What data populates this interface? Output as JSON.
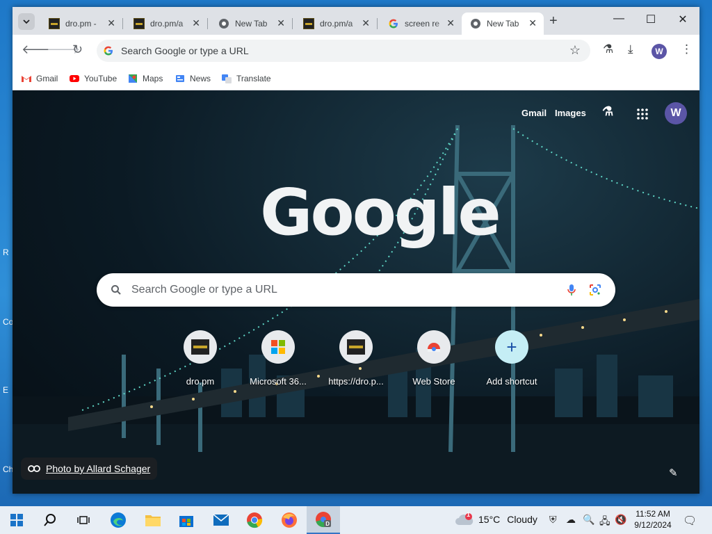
{
  "desktop": {
    "edge_letters": [
      "R",
      "Co",
      "E",
      "Ch"
    ]
  },
  "browser": {
    "tabs": [
      {
        "title": "dro.pm -",
        "favicon": "dro-pm-icon",
        "active": false
      },
      {
        "title": "dro.pm/a",
        "favicon": "dro-pm-icon",
        "active": false
      },
      {
        "title": "New Tab",
        "favicon": "chrome-icon",
        "active": false
      },
      {
        "title": "dro.pm/a",
        "favicon": "dro-pm-icon",
        "active": false
      },
      {
        "title": "screen re",
        "favicon": "google-g-icon",
        "active": false
      },
      {
        "title": "New Tab",
        "favicon": "chrome-icon",
        "active": true
      }
    ],
    "omnibox_placeholder": "Search Google or type a URL",
    "profile_initial": "W",
    "bookmarks": [
      {
        "label": "Gmail",
        "icon": "gmail-icon"
      },
      {
        "label": "YouTube",
        "icon": "youtube-icon"
      },
      {
        "label": "Maps",
        "icon": "maps-icon"
      },
      {
        "label": "News",
        "icon": "news-icon"
      },
      {
        "label": "Translate",
        "icon": "translate-icon"
      }
    ]
  },
  "ntp": {
    "header_links": {
      "gmail": "Gmail",
      "images": "Images"
    },
    "profile_initial": "W",
    "logo_text": "Google",
    "search_placeholder": "Search Google or type a URL",
    "shortcuts": [
      {
        "label": "dro.pm",
        "icon": "dro-pm-icon"
      },
      {
        "label": "Microsoft 36...",
        "icon": "microsoft-365-icon"
      },
      {
        "label": "https://dro.p...",
        "icon": "dro-pm-icon"
      },
      {
        "label": "Web Store",
        "icon": "web-store-icon"
      },
      {
        "label": "Add shortcut",
        "icon": "plus-icon"
      }
    ],
    "photo_credit": "Photo by Allard Schager"
  },
  "taskbar": {
    "weather": {
      "temp": "15°C",
      "condition": "Cloudy",
      "badge": "1"
    },
    "clock": {
      "time": "11:52 AM",
      "date": "9/12/2024"
    }
  },
  "colors": {
    "accent": "#1a73e8",
    "avatar": "#5b55a6",
    "taskbar": "#e8eef5"
  }
}
